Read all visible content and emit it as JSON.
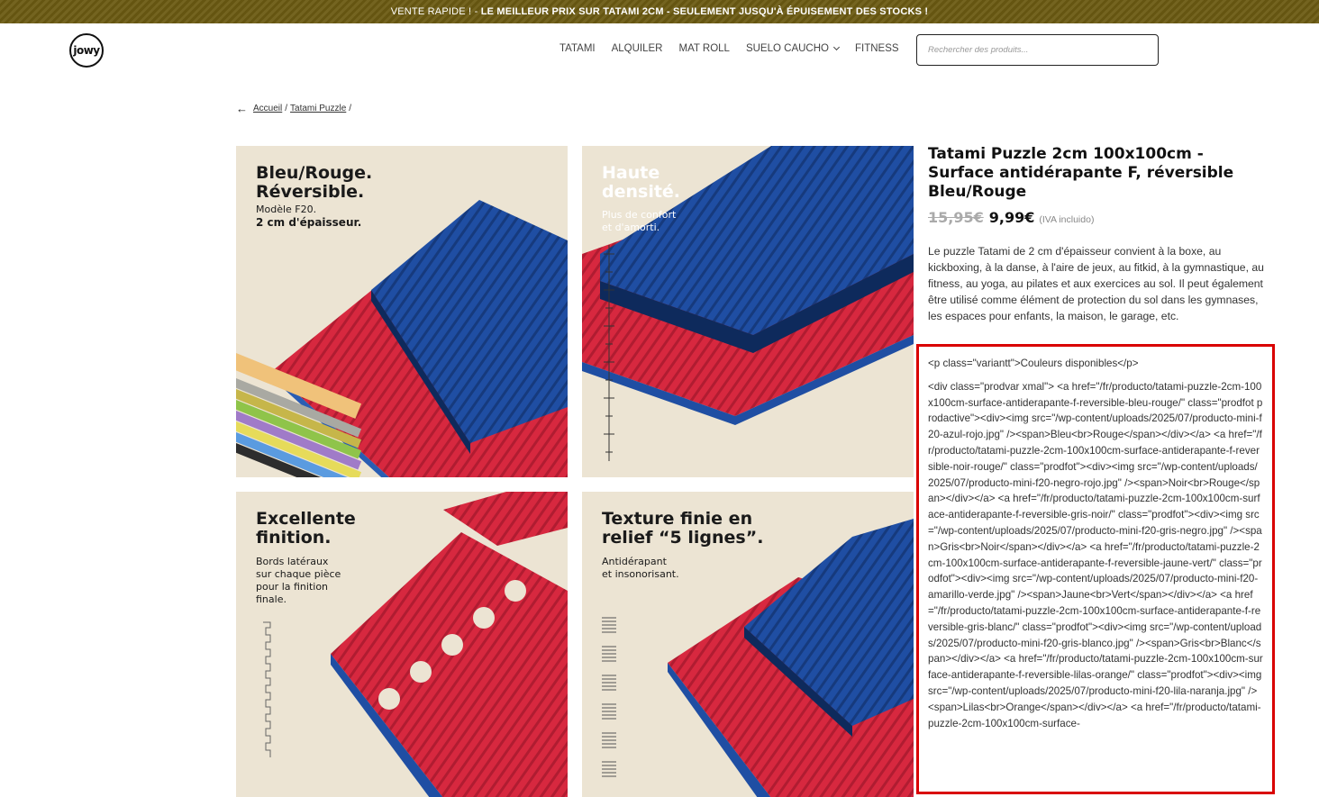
{
  "promo": {
    "prefix": "VENTE RAPIDE ! - ",
    "main": "LE MEILLEUR PRIX SUR TATAMI 2CM - SEULEMENT JUSQU'À ÉPUISEMENT DES STOCKS !"
  },
  "logo": {
    "text": "jowy"
  },
  "nav": {
    "items": [
      "TATAMI",
      "ALQUILER",
      "MAT ROLL",
      "SUELO CAUCHO",
      "FITNESS"
    ]
  },
  "search": {
    "placeholder": "Rechercher des produits..."
  },
  "breadcrumb": {
    "home": "Accueil",
    "category": "Tatami Puzzle",
    "separator": "/"
  },
  "gallery": [
    {
      "title": "Bleu/Rouge.\nRéversible.",
      "subtitle": "Modèle F20.",
      "subtitle_bold": "2 cm d'épaisseur."
    },
    {
      "title": "Haute\ndensité.",
      "subtitle": "Plus de confort\net d'amorti."
    },
    {
      "title": "Excellente\nfinition.",
      "subtitle": "Bords latéraux\nsur chaque pièce\npour la finition\nfinale."
    },
    {
      "title": "Texture finie en\nrelief “5 lignes”.",
      "subtitle": "Antidérapant\net insonorisant."
    }
  ],
  "product": {
    "title": "Tatami Puzzle 2cm 100x100cm - Surface antidérapante F, réversible Bleu/Rouge",
    "old_price": "15,95€",
    "new_price": "9,99€",
    "tax_note": "(IVA incluido)",
    "description": "Le puzzle Tatami de 2 cm d'épaisseur convient à la boxe, au kickboxing, à la danse, à l'aire de jeux, au fitkid, à la gymnastique, au fitness, au yoga, au pilates et aux exercices au sol. Il peut également être utilisé comme élément de protection du sol dans les gymnases, les espaces pour enfants, la maison, le garage, etc."
  },
  "raw_code": {
    "line1": "<p class=\"variantt\">Couleurs disponibles</p>",
    "block": "<div class=\"prodvar xmal\"> <a href=\"/fr/producto/tatami-puzzle-2cm-100x100cm-surface-antiderapante-f-reversible-bleu-rouge/\" class=\"prodfot prodactive\"><div><img src=\"/wp-content/uploads/2025/07/producto-mini-f20-azul-rojo.jpg\" /><span>Bleu<br>Rouge</span></div></a> <a href=\"/fr/producto/tatami-puzzle-2cm-100x100cm-surface-antiderapante-f-reversible-noir-rouge/\" class=\"prodfot\"><div><img src=\"/wp-content/uploads/2025/07/producto-mini-f20-negro-rojo.jpg\" /><span>Noir<br>Rouge</span></div></a> <a href=\"/fr/producto/tatami-puzzle-2cm-100x100cm-surface-antiderapante-f-reversible-gris-noir/\" class=\"prodfot\"><div><img src=\"/wp-content/uploads/2025/07/producto-mini-f20-gris-negro.jpg\" /><span>Gris<br>Noir</span></div></a> <a href=\"/fr/producto/tatami-puzzle-2cm-100x100cm-surface-antiderapante-f-reversible-jaune-vert/\" class=\"prodfot\"><div><img src=\"/wp-content/uploads/2025/07/producto-mini-f20-amarillo-verde.jpg\" /><span>Jaune<br>Vert</span></div></a> <a href=\"/fr/producto/tatami-puzzle-2cm-100x100cm-surface-antiderapante-f-reversible-gris-blanc/\" class=\"prodfot\"><div><img src=\"/wp-content/uploads/2025/07/producto-mini-f20-gris-blanco.jpg\" /><span>Gris<br>Blanc</span></div></a> <a href=\"/fr/producto/tatami-puzzle-2cm-100x100cm-surface-antiderapante-f-reversible-lilas-orange/\" class=\"prodfot\"><div><img src=\"/wp-content/uploads/2025/07/producto-mini-f20-lila-naranja.jpg\" /><span>Lilas<br>Orange</span></div></a> <a href=\"/fr/producto/tatami-puzzle-2cm-100x100cm-surface-"
  },
  "colors": {
    "promo_bg": "#6b5a12",
    "red_mat": "#d7283f",
    "blue_mat": "#1f4ea3",
    "beige_bg": "#ece4d3",
    "highlight_border": "#d90000"
  }
}
